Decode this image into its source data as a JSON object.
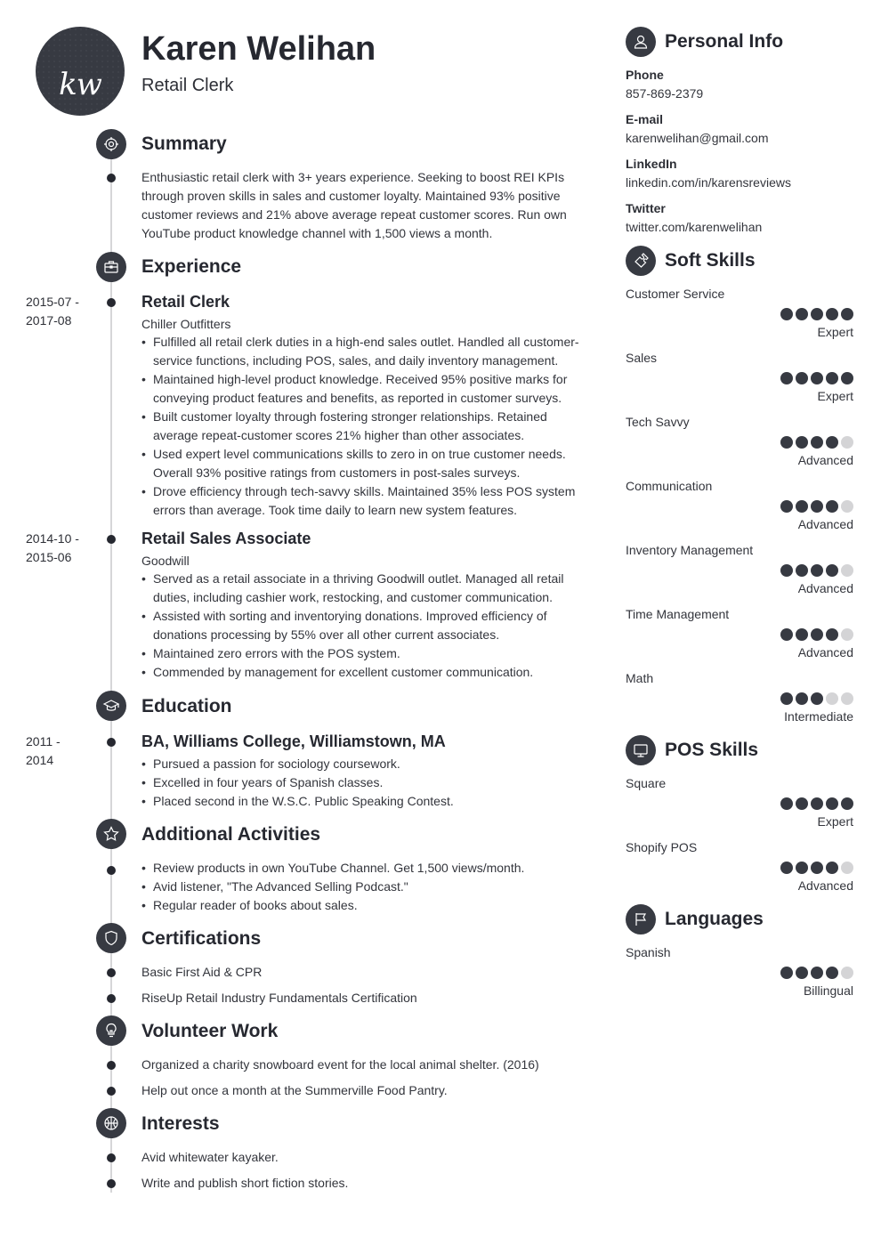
{
  "header": {
    "initials": "kw",
    "name": "Karen Welihan",
    "title": "Retail Clerk"
  },
  "summary": {
    "heading": "Summary",
    "icon": "target-icon",
    "text": "Enthusiastic retail clerk with 3+ years experience. Seeking to boost REI KPIs through proven skills in sales and customer loyalty. Maintained 93% positive customer reviews and 21% above average repeat customer scores. Run own YouTube product knowledge channel with 1,500 views a month."
  },
  "experience": {
    "heading": "Experience",
    "icon": "briefcase-icon",
    "jobs": [
      {
        "date_start": "2015-07 -",
        "date_end": "2017-08",
        "title": "Retail Clerk",
        "company": "Chiller Outfitters",
        "bullets": [
          "Fulfilled all retail clerk duties in a high-end sales outlet. Handled all customer-service functions, including POS, sales, and daily inventory management.",
          "Maintained high-level product knowledge. Received 95% positive marks for conveying product features and benefits, as reported in customer surveys.",
          "Built customer loyalty through fostering stronger relationships. Retained average repeat-customer scores 21% higher than other associates.",
          "Used expert level communications skills to zero in on true customer needs. Overall 93% positive ratings from customers in post-sales surveys.",
          "Drove efficiency through tech-savvy skills. Maintained 35% less POS system errors than average. Took time daily to learn new system features."
        ]
      },
      {
        "date_start": "2014-10 -",
        "date_end": "2015-06",
        "title": "Retail Sales Associate",
        "company": "Goodwill",
        "bullets": [
          "Served as a retail associate in a thriving Goodwill outlet. Managed all retail duties, including cashier work, restocking, and customer communication.",
          "Assisted with sorting and inventorying donations. Improved efficiency of donations processing by 55% over all other current associates.",
          "Maintained zero errors with the POS system.",
          "Commended by management for excellent customer communication."
        ]
      }
    ]
  },
  "education": {
    "heading": "Education",
    "icon": "graduation-cap-icon",
    "date_start": "2011 -",
    "date_end": "2014",
    "degree": "BA, Williams College, Williamstown, MA",
    "bullets": [
      "Pursued a passion for sociology coursework.",
      "Excelled in four years of Spanish classes.",
      "Placed second in the W.S.C. Public Speaking Contest."
    ]
  },
  "activities": {
    "heading": "Additional Activities",
    "icon": "star-icon",
    "bullets": [
      "Review products in own YouTube Channel. Get 1,500 views/month.",
      "Avid listener, \"The Advanced Selling Podcast.\"",
      "Regular reader of books about sales."
    ]
  },
  "certifications": {
    "heading": "Certifications",
    "icon": "shield-icon",
    "items": [
      "Basic First Aid & CPR",
      "RiseUp Retail Industry Fundamentals Certification"
    ]
  },
  "volunteer": {
    "heading": "Volunteer Work",
    "icon": "lightbulb-icon",
    "items": [
      "Organized a charity snowboard event for the local animal shelter. (2016)",
      "Help out once a month at the Summerville Food Pantry."
    ]
  },
  "interests": {
    "heading": "Interests",
    "icon": "basketball-icon",
    "items": [
      "Avid whitewater kayaker.",
      "Write and publish short fiction stories."
    ]
  },
  "personal_info": {
    "heading": "Personal Info",
    "icon": "user-icon",
    "fields": [
      {
        "label": "Phone",
        "value": "857-869-2379"
      },
      {
        "label": "E-mail",
        "value": "karenwelihan@gmail.com"
      },
      {
        "label": "LinkedIn",
        "value": "linkedin.com/in/karensreviews"
      },
      {
        "label": "Twitter",
        "value": "twitter.com/karenwelihan"
      }
    ]
  },
  "soft_skills": {
    "heading": "Soft Skills",
    "icon": "puzzle-icon",
    "items": [
      {
        "name": "Customer Service",
        "rating": 5,
        "max": 5,
        "level": "Expert"
      },
      {
        "name": "Sales",
        "rating": 5,
        "max": 5,
        "level": "Expert"
      },
      {
        "name": "Tech Savvy",
        "rating": 4,
        "max": 5,
        "level": "Advanced"
      },
      {
        "name": "Communication",
        "rating": 4,
        "max": 5,
        "level": "Advanced"
      },
      {
        "name": "Inventory Management",
        "rating": 4,
        "max": 5,
        "level": "Advanced"
      },
      {
        "name": "Time Management",
        "rating": 4,
        "max": 5,
        "level": "Advanced"
      },
      {
        "name": "Math",
        "rating": 3,
        "max": 5,
        "level": "Intermediate"
      }
    ]
  },
  "pos_skills": {
    "heading": "POS Skills",
    "icon": "monitor-icon",
    "items": [
      {
        "name": "Square",
        "rating": 5,
        "max": 5,
        "level": "Expert"
      },
      {
        "name": "Shopify POS",
        "rating": 4,
        "max": 5,
        "level": "Advanced"
      }
    ]
  },
  "languages": {
    "heading": "Languages",
    "icon": "flag-icon",
    "items": [
      {
        "name": "Spanish",
        "rating": 4,
        "max": 5,
        "level": "Billingual"
      }
    ]
  },
  "colors": {
    "accent": "#373a42",
    "text": "#2d2f36",
    "rating_off": "#d4d4d6",
    "timeline": "#d6d6d8"
  }
}
